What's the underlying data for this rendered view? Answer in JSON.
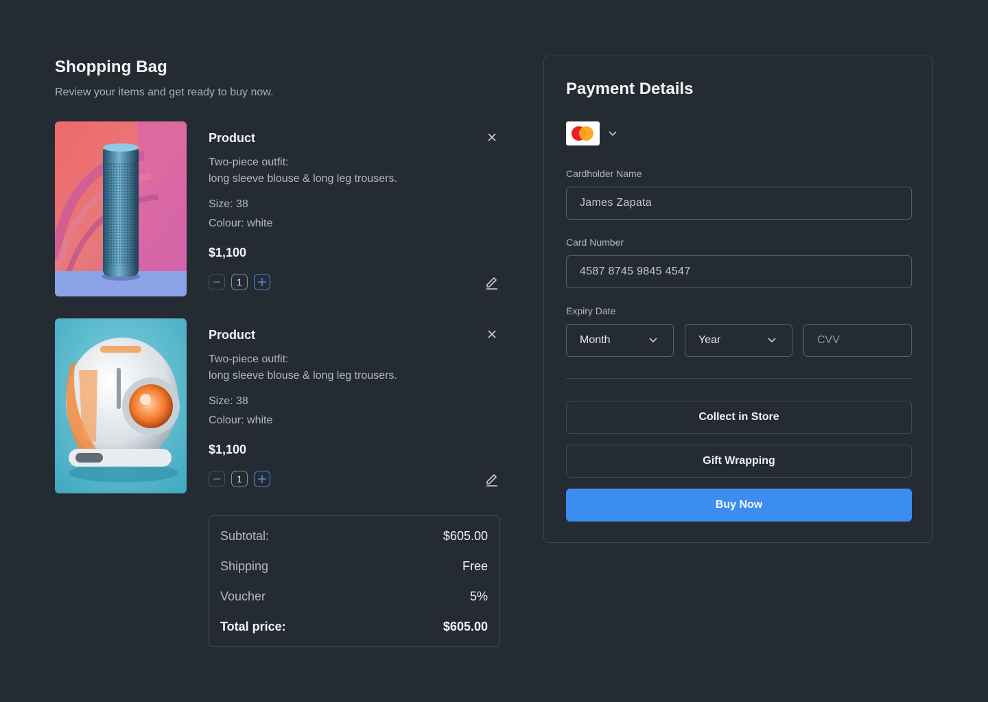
{
  "bag": {
    "title": "Shopping Bag",
    "subtitle": "Review your items and get ready to buy now."
  },
  "items": [
    {
      "name": "Product",
      "desc_line1": "Two-piece outfit:",
      "desc_line2": "long sleeve blouse & long leg trousers.",
      "size": "Size: 38",
      "colour": "Colour: white",
      "price": "$1,100",
      "qty": "1",
      "image_icon": "speaker-product-image"
    },
    {
      "name": "Product",
      "desc_line1": "Two-piece outfit:",
      "desc_line2": "long sleeve blouse & long leg trousers.",
      "size": "Size: 38",
      "colour": "Colour: white",
      "price": "$1,100",
      "qty": "1",
      "image_icon": "robot-helmet-product-image"
    }
  ],
  "summary": {
    "subtotal_label": "Subtotal:",
    "subtotal_value": "$605.00",
    "shipping_label": "Shipping",
    "shipping_value": "Free",
    "voucher_label": "Voucher",
    "voucher_value": "5%",
    "total_label": "Total price:",
    "total_value": "$605.00"
  },
  "payment": {
    "title": "Payment Details",
    "card_brand_icon": "mastercard-icon",
    "cardholder_label": "Cardholder Name",
    "cardholder_value": "James Zapata",
    "card_number_label": "Card Number",
    "card_number_value": "4587 8745 9845 4547",
    "expiry_label": "Expiry Date",
    "month_label": "Month",
    "year_label": "Year",
    "cvv_placeholder": "CVV",
    "collect_label": "Collect in Store",
    "gift_label": "Gift Wrapping",
    "buy_label": "Buy Now"
  },
  "colors": {
    "background": "#252b33",
    "accent": "#3b8ef0",
    "border": "#434a55"
  }
}
